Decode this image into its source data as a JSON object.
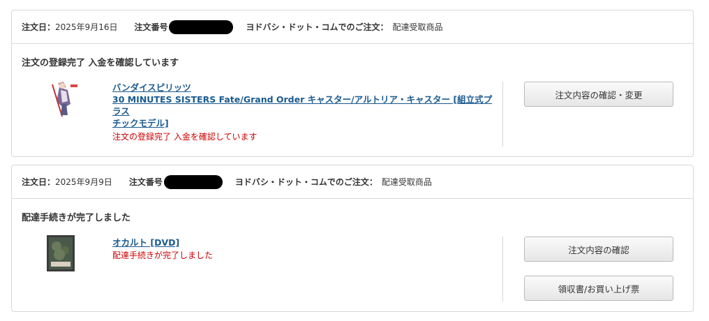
{
  "orders": [
    {
      "date_label": "注文日：",
      "date_value": "2025年9月16日",
      "order_number_label": "注文番号",
      "shop_label": "ヨドバシ・ドット・コムでのご注文：",
      "shop_value": "配達受取商品",
      "status_title": "注文の登録完了 入金を確認しています",
      "item_lines": [
        "バンダイスピリッツ",
        "30 MINUTES SISTERS Fate/Grand Order キャスター/アルトリア・キャスター [組立式プラス",
        "チックモデル]"
      ],
      "item_status": "注文の登録完了 入金を確認しています",
      "thumbnail_icon": "figure-product-thumbnail",
      "buttons": [
        "注文内容の確認・変更"
      ]
    },
    {
      "date_label": "注文日：",
      "date_value": "2025年9月9日",
      "order_number_label": "注文番号",
      "shop_label": "ヨドバシ・ドット・コムでのご注文：",
      "shop_value": "配達受取商品",
      "status_title": "配達手続きが完了しました",
      "item_lines": [
        "オカルト [DVD]"
      ],
      "item_status": "配達手続きが完了しました",
      "thumbnail_icon": "dvd-cover-thumbnail",
      "buttons": [
        "注文内容の確認",
        "領収書/お買い上げ票"
      ]
    }
  ],
  "colors": {
    "link": "#1a5a8f",
    "status_red": "#cc0000",
    "border": "#d8d8d8",
    "redaction": "#000000"
  }
}
